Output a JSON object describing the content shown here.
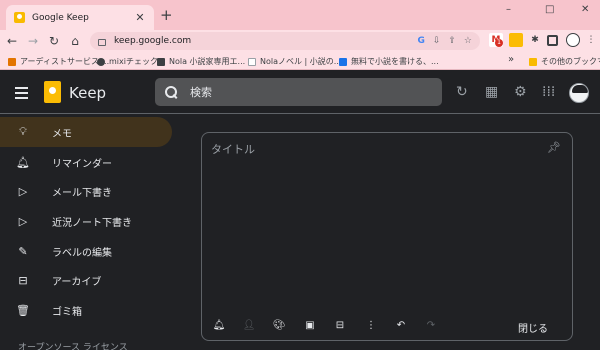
{
  "browser": {
    "tab_title": "Google Keep",
    "new_tab": "+",
    "url": "keep.google.com",
    "window_controls": [
      "–",
      "□",
      "✕"
    ],
    "extension_badge": "1"
  },
  "bookmarks": [
    {
      "label": "アーディストサービス ...",
      "icon": "apps-icon"
    },
    {
      "label": "mixiチェック",
      "icon": "mixi-icon"
    },
    {
      "label": "Nola 小説家専用エ...",
      "icon": "nola-icon"
    },
    {
      "label": "Nolaノベル | 小説の...",
      "icon": "nola-novel-icon"
    },
    {
      "label": "無料で小説を書ける、...",
      "icon": "page-icon"
    }
  ],
  "bookmarks_overflow": "»",
  "other_bookmarks": "その他のブックマーク",
  "keep": {
    "app_name": "Keep",
    "search_placeholder": "検索",
    "sidebar": [
      {
        "label": "メモ",
        "icon": "lightbulb-icon",
        "active": true
      },
      {
        "label": "リマインダー",
        "icon": "bell-icon",
        "active": false
      },
      {
        "label": "メール下書き",
        "icon": "label-icon",
        "active": false
      },
      {
        "label": "近況ノート下書き",
        "icon": "label-icon",
        "active": false
      },
      {
        "label": "ラベルの編集",
        "icon": "pencil-icon",
        "active": false
      },
      {
        "label": "アーカイブ",
        "icon": "archive-icon",
        "active": false
      },
      {
        "label": "ゴミ箱",
        "icon": "trash-icon",
        "active": false
      }
    ],
    "footer": "オープンソース ライセンス",
    "note": {
      "title_placeholder": "タイトル",
      "close_label": "閉じる"
    }
  },
  "colors": {
    "tab_strip": "#f7c4cc",
    "toolbar": "#fde0e5",
    "keep_bg": "#202124",
    "active_item": "#41331c",
    "keep_yellow": "#fbbc04"
  }
}
